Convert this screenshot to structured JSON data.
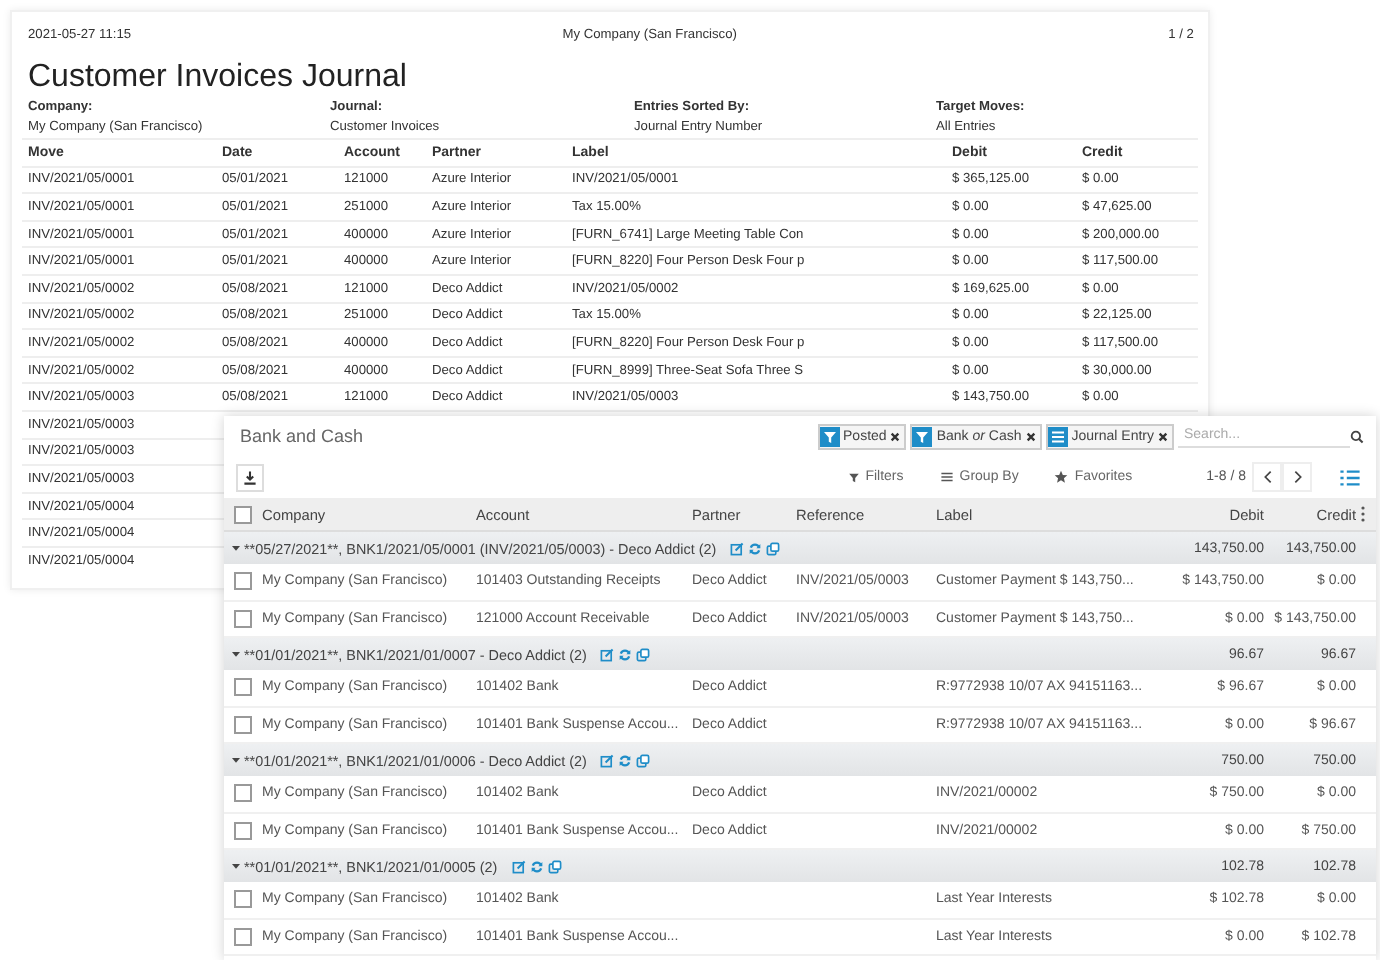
{
  "report": {
    "timestamp": "2021-05-27 11:15",
    "company_header": "My Company (San Francisco)",
    "page": "1 / 2",
    "title": "Customer Invoices Journal",
    "info": [
      {
        "label": "Company:",
        "value": "My Company (San Francisco)"
      },
      {
        "label": "Journal:",
        "value": "Customer Invoices"
      },
      {
        "label": "Entries Sorted By:",
        "value": "Journal Entry Number"
      },
      {
        "label": "Target Moves:",
        "value": "All Entries"
      }
    ],
    "columns": [
      "Move",
      "Date",
      "Account",
      "Partner",
      "Label",
      "Debit",
      "Credit"
    ],
    "rows": [
      [
        "INV/2021/05/0001",
        "05/01/2021",
        "121000",
        "Azure Interior",
        "INV/2021/05/0001",
        "$ 365,125.00",
        "$ 0.00"
      ],
      [
        "INV/2021/05/0001",
        "05/01/2021",
        "251000",
        "Azure Interior",
        "Tax 15.00%",
        "$ 0.00",
        "$ 47,625.00"
      ],
      [
        "INV/2021/05/0001",
        "05/01/2021",
        "400000",
        "Azure Interior",
        "[FURN_6741] Large Meeting Table Con",
        "$ 0.00",
        "$ 200,000.00"
      ],
      [
        "INV/2021/05/0001",
        "05/01/2021",
        "400000",
        "Azure Interior",
        "[FURN_8220] Four Person Desk Four p",
        "$ 0.00",
        "$ 117,500.00"
      ],
      [
        "INV/2021/05/0002",
        "05/08/2021",
        "121000",
        "Deco Addict",
        "INV/2021/05/0002",
        "$ 169,625.00",
        "$ 0.00"
      ],
      [
        "INV/2021/05/0002",
        "05/08/2021",
        "251000",
        "Deco Addict",
        "Tax 15.00%",
        "$ 0.00",
        "$ 22,125.00"
      ],
      [
        "INV/2021/05/0002",
        "05/08/2021",
        "400000",
        "Deco Addict",
        "[FURN_8220] Four Person Desk Four p",
        "$ 0.00",
        "$ 117,500.00"
      ],
      [
        "INV/2021/05/0002",
        "05/08/2021",
        "400000",
        "Deco Addict",
        "[FURN_8999] Three-Seat Sofa Three S",
        "$ 0.00",
        "$ 30,000.00"
      ],
      [
        "INV/2021/05/0003",
        "05/08/2021",
        "121000",
        "Deco Addict",
        "INV/2021/05/0003",
        "$ 143,750.00",
        "$ 0.00"
      ],
      [
        "INV/2021/05/0003"
      ],
      [
        "INV/2021/05/0003"
      ],
      [
        "INV/2021/05/0003"
      ],
      [
        "INV/2021/05/0004"
      ],
      [
        "INV/2021/05/0004"
      ],
      [
        "INV/2021/05/0004"
      ]
    ]
  },
  "list_view": {
    "title": "Bank and Cash",
    "facets": [
      {
        "kind": "filter",
        "label": "Posted"
      },
      {
        "kind": "filter",
        "label": "Bank *or* Cash"
      },
      {
        "kind": "group",
        "label": "Journal Entry"
      }
    ],
    "search": {
      "placeholder": "Search..."
    },
    "buttons": [
      "Filters",
      "Group By",
      "Favorites"
    ],
    "pager": "1-8 / 8",
    "header_checked": false,
    "columns": [
      "Company",
      "Account",
      "Partner",
      "Reference",
      "Label",
      "Debit",
      "Credit"
    ],
    "groups": [
      {
        "title": "**05/27/2021**, BNK1/2021/05/0001 (INV/2021/05/0003) - Deco Addict (2)",
        "expanded": true,
        "debit": "143,750.00",
        "credit": "143,750.00",
        "rows": [
          {
            "checked": false,
            "cells": [
              "My Company (San Francisco)",
              "101403 Outstanding Receipts",
              "Deco Addict",
              "INV/2021/05/0003",
              "Customer Payment $ 143,750...",
              "$ 143,750.00",
              "$ 0.00"
            ]
          },
          {
            "checked": false,
            "cells": [
              "My Company (San Francisco)",
              "121000 Account Receivable",
              "Deco Addict",
              "INV/2021/05/0003",
              "Customer Payment $ 143,750...",
              "$ 0.00",
              "$ 143,750.00"
            ]
          }
        ]
      },
      {
        "title": "**01/01/2021**, BNK1/2021/01/0007 - Deco Addict (2)",
        "expanded": true,
        "debit": "96.67",
        "credit": "96.67",
        "rows": [
          {
            "checked": false,
            "cells": [
              "My Company (San Francisco)",
              "101402 Bank",
              "Deco Addict",
              "",
              "R:9772938 10/07 AX 94151163...",
              "$ 96.67",
              "$ 0.00"
            ]
          },
          {
            "checked": false,
            "cells": [
              "My Company (San Francisco)",
              "101401 Bank Suspense Accou...",
              "Deco Addict",
              "",
              "R:9772938 10/07 AX 94151163...",
              "$ 0.00",
              "$ 96.67"
            ]
          }
        ]
      },
      {
        "title": "**01/01/2021**, BNK1/2021/01/0006 - Deco Addict (2)",
        "expanded": true,
        "debit": "750.00",
        "credit": "750.00",
        "rows": [
          {
            "checked": false,
            "cells": [
              "My Company (San Francisco)",
              "101402 Bank",
              "Deco Addict",
              "",
              "INV/2021/00002",
              "$ 750.00",
              "$ 0.00"
            ]
          },
          {
            "checked": false,
            "cells": [
              "My Company (San Francisco)",
              "101401 Bank Suspense Accou...",
              "Deco Addict",
              "",
              "INV/2021/00002",
              "$ 0.00",
              "$ 750.00"
            ]
          }
        ]
      },
      {
        "title": "**01/01/2021**, BNK1/2021/01/0005 (2)",
        "expanded": true,
        "debit": "102.78",
        "credit": "102.78",
        "rows": [
          {
            "checked": false,
            "cells": [
              "My Company (San Francisco)",
              "101402 Bank",
              "",
              "",
              "Last Year Interests",
              "$ 102.78",
              "$ 0.00"
            ]
          },
          {
            "checked": false,
            "cells": [
              "My Company (San Francisco)",
              "101401 Bank Suspense Accou...",
              "",
              "",
              "Last Year Interests",
              "$ 0.00",
              "$ 102.78"
            ]
          }
        ]
      }
    ]
  }
}
